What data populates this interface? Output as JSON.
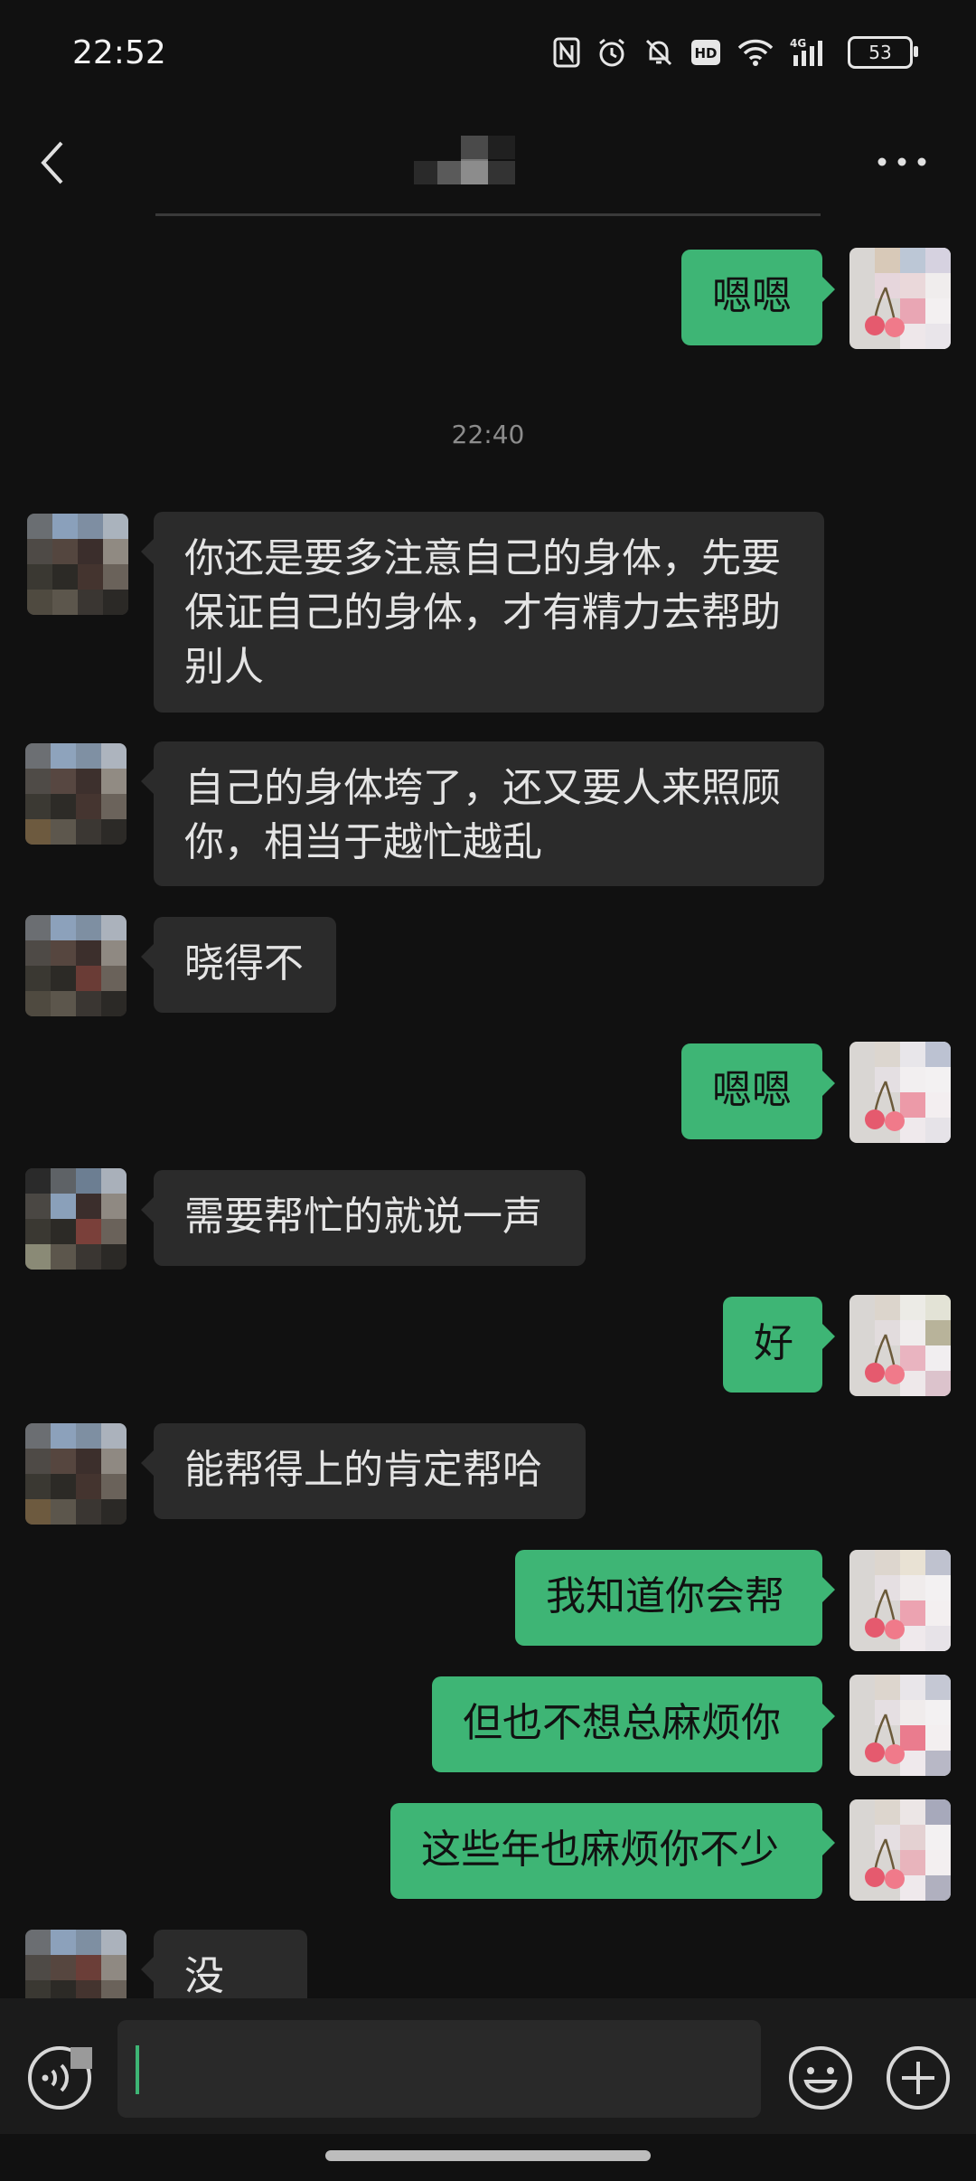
{
  "status_bar": {
    "time": "22:52",
    "battery": "53",
    "icons": [
      "nfc-icon",
      "alarm-icon",
      "mute-icon",
      "hd-icon",
      "wifi-icon",
      "4g-signal-icon",
      "battery-icon"
    ],
    "network": "4G"
  },
  "header": {
    "back_icon": "back-icon",
    "more_icon": "more-icon"
  },
  "chat": {
    "timestamp": "22:40",
    "messages": [
      {
        "side": "right",
        "text": "嗯嗯"
      },
      {
        "side": "left",
        "text": "你还是要多注意自己的身体，先要\n保证自己的身体，才有精力去帮助\n别人"
      },
      {
        "side": "left",
        "text": "自己的身体垮了，还又要人来照顾\n你，相当于越忙越乱"
      },
      {
        "side": "left",
        "text": "晓得不"
      },
      {
        "side": "right",
        "text": "嗯嗯"
      },
      {
        "side": "left",
        "text": "需要帮忙的就说一声"
      },
      {
        "side": "right",
        "text": "好"
      },
      {
        "side": "left",
        "text": "能帮得上的肯定帮哈"
      },
      {
        "side": "right",
        "text": "我知道你会帮"
      },
      {
        "side": "right",
        "text": "但也不想总麻烦你"
      },
      {
        "side": "right",
        "text": "这些年也麻烦你不少"
      },
      {
        "side": "left",
        "text": "没事，"
      }
    ]
  },
  "input_bar": {
    "voice_icon": "voice-icon",
    "emoji_icon": "emoji-icon",
    "plus_icon": "plus-icon",
    "value": ""
  },
  "colors": {
    "background": "#111111",
    "bubble_left": "#2b2b2b",
    "bubble_right": "#3eb575"
  }
}
